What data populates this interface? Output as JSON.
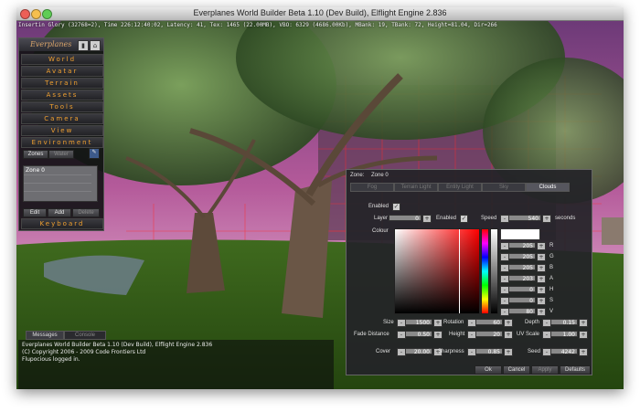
{
  "window": {
    "title": "Everplanes World Builder Beta 1.10 (Dev Build), Elflight Engine 2.836"
  },
  "hud": {
    "status": "Insertin Glory (32768=2), Time 226:12:40:02, Latency: 41, Tex: 1465 (22.00MB), VBO: 6329 (4686.00Kb), MBank: 19, TBank: 72, Height=81.04, Dir=266"
  },
  "menu": {
    "brand": "Everplanes",
    "items": [
      "World",
      "Avatar",
      "Terrain",
      "Assets",
      "Tools",
      "Camera",
      "View",
      "Environment",
      "Keyboard"
    ],
    "sub_tabs": {
      "zones": "Zones",
      "water": "Water"
    },
    "zone_list": [
      "Zone 0"
    ],
    "actions": {
      "edit": "Edit",
      "add": "Add",
      "delete": "Delete"
    }
  },
  "console": {
    "tabs": {
      "messages": "Messages",
      "console": "Console"
    },
    "lines": [
      "Everplanes World Builder Beta 1.10 (Dev Build), Elflight Engine 2.836",
      "(C) Copyright 2006 - 2009 Code Frontiers Ltd",
      "Flupocious logged in."
    ]
  },
  "zone_panel": {
    "zone_label": "Zone:",
    "zone_value": "Zone 0",
    "tabs": [
      "Fog",
      "Terrain Light",
      "Entity Light",
      "Sky",
      "Clouds"
    ],
    "active_tab": "Clouds",
    "enabled_label": "Enabled",
    "layer_label": "Layer",
    "layer_value": "0",
    "layer_enabled_label": "Enabled",
    "speed_label": "Speed",
    "speed_value": "540",
    "speed_unit": "seconds",
    "colour_label": "Colour",
    "color_channels": [
      {
        "label": "R",
        "value": "205"
      },
      {
        "label": "G",
        "value": "205"
      },
      {
        "label": "B",
        "value": "205"
      },
      {
        "label": "A",
        "value": "203"
      },
      {
        "label": "H",
        "value": "0"
      },
      {
        "label": "S",
        "value": "0"
      },
      {
        "label": "V",
        "value": "80"
      }
    ],
    "size_label": "Size",
    "size_value": "1500",
    "rotation_label": "Rotation",
    "rotation_value": "60",
    "depth_label": "Depth",
    "depth_value": "0.15",
    "fade_label": "Fade Distance",
    "fade_value": "0.50",
    "height_label": "Height",
    "height_value": "20",
    "uvscale_label": "UV Scale",
    "uvscale_value": "1.00",
    "cover_label": "Cover",
    "cover_value": "20.00",
    "sharpness_label": "Sharpness",
    "sharpness_value": "0.85",
    "seed_label": "Seed",
    "seed_value": "4242",
    "buttons": {
      "ok": "Ok",
      "cancel": "Cancel",
      "apply": "Apply",
      "defaults": "Defaults"
    },
    "spin_minus": "-",
    "spin_plus": "+"
  },
  "colors": {
    "menu_text": "#f0a030",
    "brand_text": "#d9a46a",
    "panel_bg": "#242428"
  }
}
